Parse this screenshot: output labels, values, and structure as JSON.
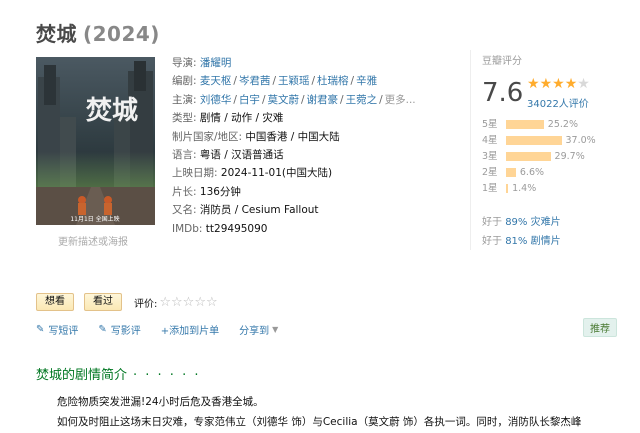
{
  "movie": {
    "title": "焚城",
    "year": "(2024)"
  },
  "poster": {
    "link_text": "更新描述或海报",
    "title_art": "焚城",
    "bottom_text": "11月1日 全国上映"
  },
  "info": {
    "director_label": "导演:",
    "director": "潘耀明",
    "writers_label": "编剧:",
    "writers": [
      "麦天枢",
      "岑君茜",
      "王颖瑶",
      "杜瑞榕",
      "辛雅"
    ],
    "cast_label": "主演:",
    "cast": [
      "刘德华",
      "白宇",
      "莫文蔚",
      "谢君豪",
      "王菀之"
    ],
    "cast_more": "更多...",
    "genre_label": "类型:",
    "genre": "剧情 / 动作 / 灾难",
    "country_label": "制片国家/地区:",
    "country": "中国香港 / 中国大陆",
    "language_label": "语言:",
    "language": "粤语 / 汉语普通话",
    "release_label": "上映日期:",
    "release": "2024-11-01(中国大陆)",
    "runtime_label": "片长:",
    "runtime": "136分钟",
    "aka_label": "又名:",
    "aka": "消防员 / Cesium Fallout",
    "imdb_label": "IMDb:",
    "imdb": "tt29495090"
  },
  "rating": {
    "label": "豆瓣评分",
    "score": "7.6",
    "stars_value": 4,
    "votes": "34022人评价",
    "distribution": [
      {
        "label": "5星",
        "pct": "25.2%",
        "value": 25.2
      },
      {
        "label": "4星",
        "pct": "37.0%",
        "value": 37.0
      },
      {
        "label": "3星",
        "pct": "29.7%",
        "value": 29.7
      },
      {
        "label": "2星",
        "pct": "6.6%",
        "value": 6.6
      },
      {
        "label": "1星",
        "pct": "1.4%",
        "value": 1.4
      }
    ],
    "better1_pre": "好于 ",
    "better1_pct": "89%",
    "better1_genre": " 灾难片",
    "better2_pre": "好于 ",
    "better2_pct": "81%",
    "better2_genre": " 剧情片"
  },
  "buttons": {
    "want": "想看",
    "watched": "看过",
    "rate_label": "评价:",
    "rate_stars": "☆☆☆☆☆"
  },
  "actions": {
    "short_review": "写短评",
    "review": "写影评",
    "add_list": "+添加到片单",
    "share": "分享到",
    "recommend": "推荐"
  },
  "summary": {
    "title": "焚城的剧情简介",
    "dots": "· · · · · ·",
    "line1": "危险物质突发泄漏!24小时后危及香港全城。",
    "line2": "如何及时阻止这场末日灾难，专家范伟立（刘德华 饰）与Cecilia（莫文蔚 饰）各执一词。同时，消防队长黎杰峰"
  },
  "colors": {
    "link": "#3377aa",
    "star": "#ffac2d",
    "bar": "#ffd596",
    "section": "#007722"
  }
}
